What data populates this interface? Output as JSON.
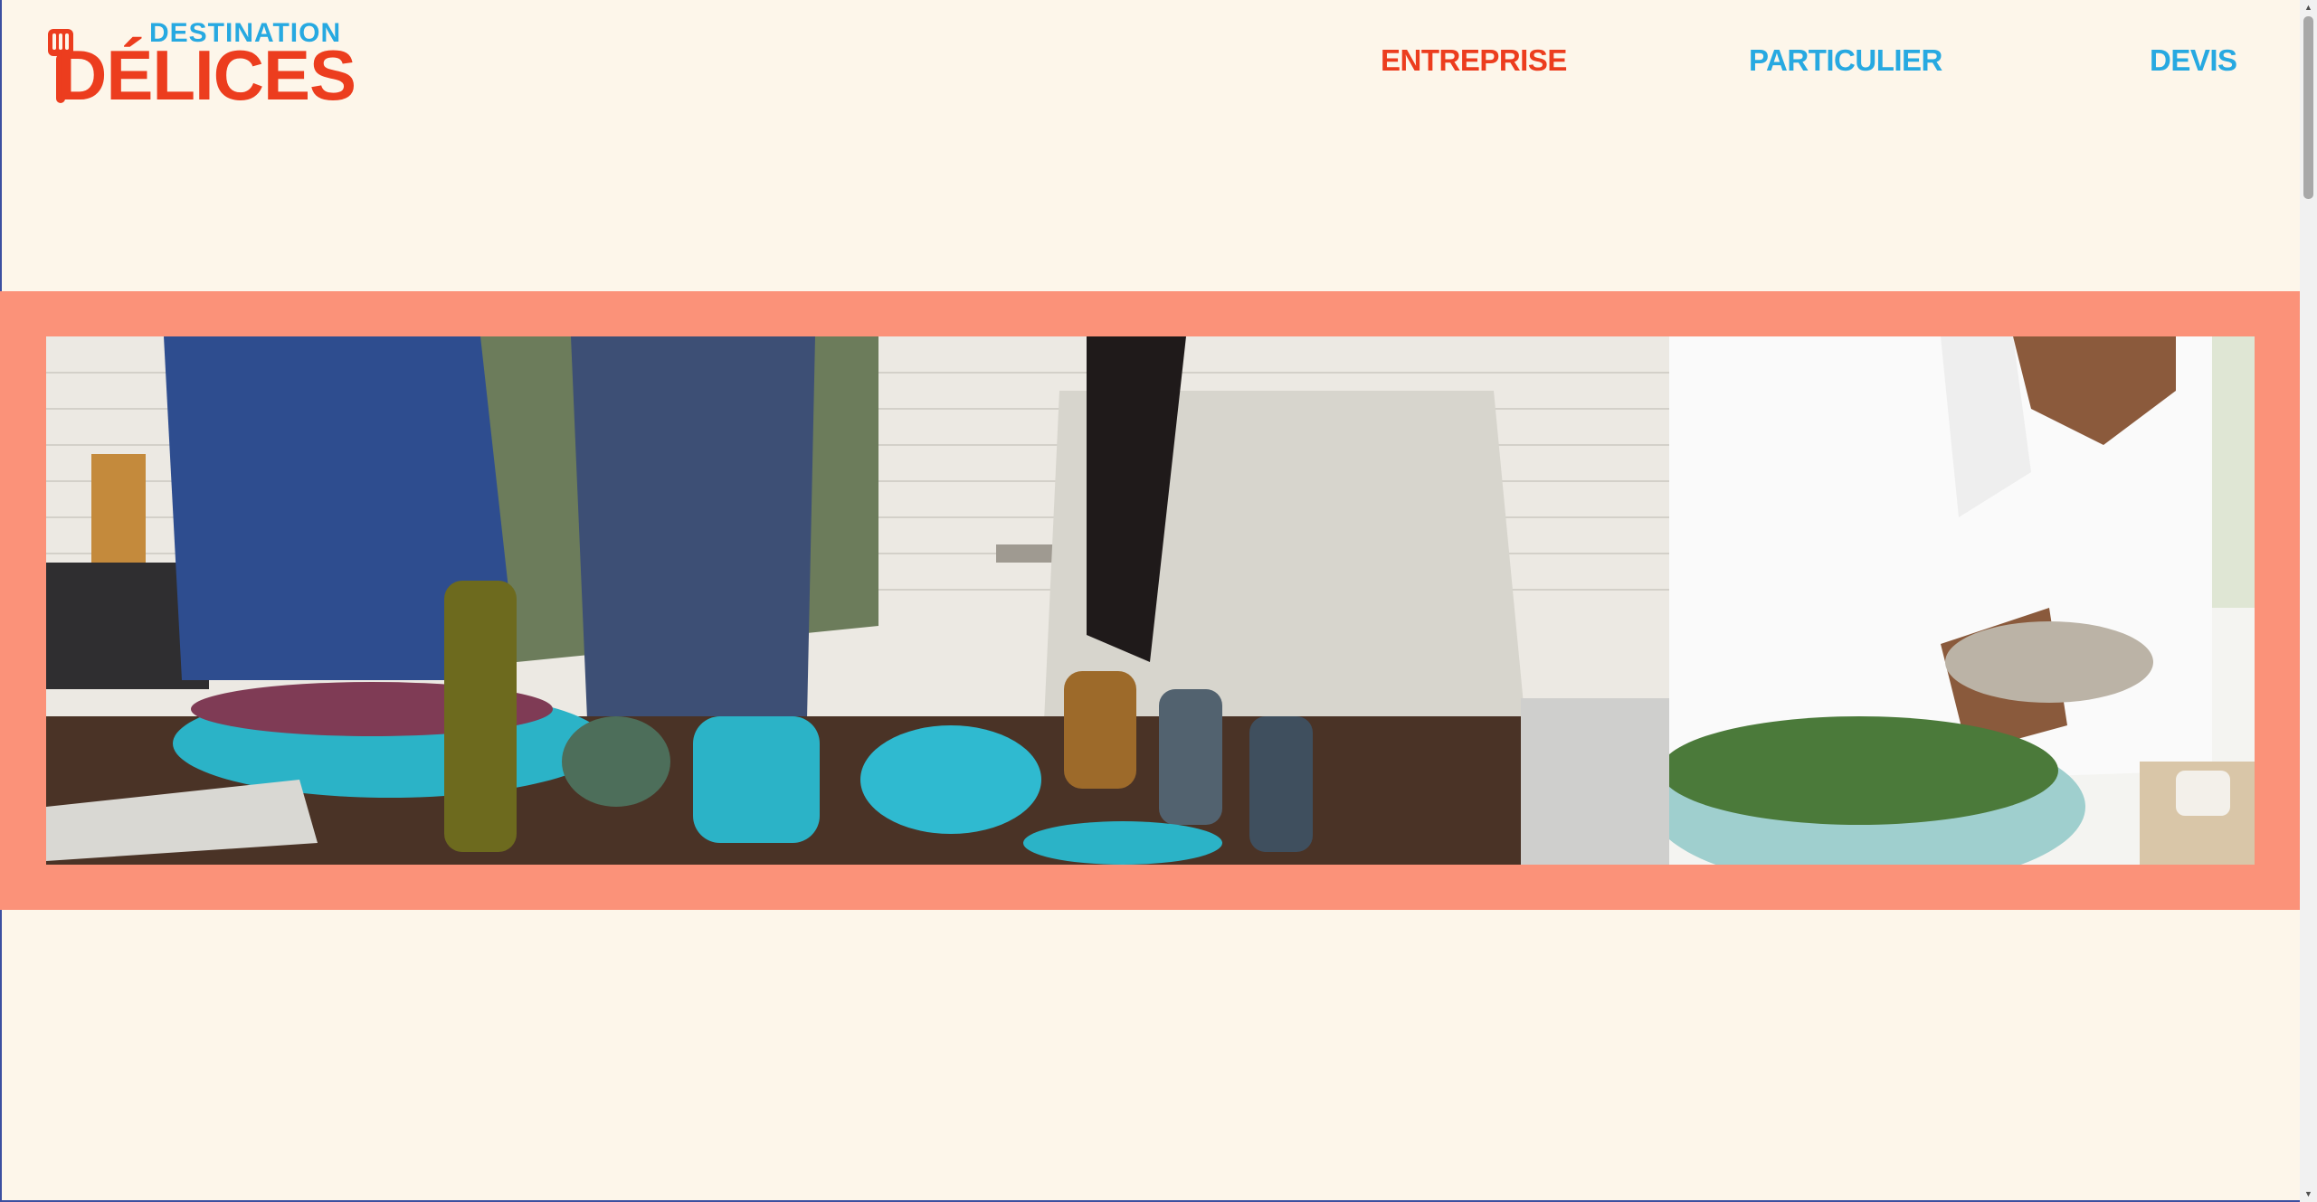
{
  "brand": {
    "logo_top": "DESTINATION",
    "logo_main": "DÉLICES",
    "colors": {
      "red": "#ec3d1e",
      "blue": "#27a9e1",
      "background": "#fdf6ea",
      "banner": "#fb9279"
    }
  },
  "nav": {
    "entreprise": "ENTREPRISE",
    "particulier": "PARTICULIER",
    "devis": "DEVIS"
  },
  "icons": {
    "logo_icon": "spatula-fork-icon"
  }
}
